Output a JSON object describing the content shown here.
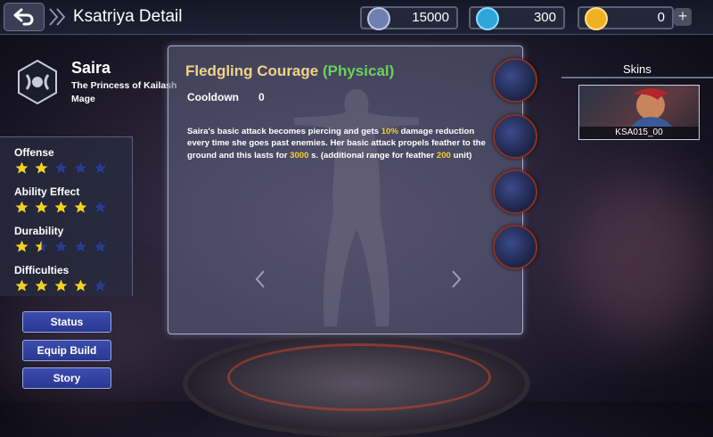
{
  "header": {
    "back_icon": "back-arrow-icon",
    "title": "Ksatriya Detail"
  },
  "resources": [
    {
      "name": "battle-point",
      "icon": "battle-point-icon",
      "value": "15000",
      "color": "#6f7fb0"
    },
    {
      "name": "diamond",
      "icon": "diamond-icon",
      "value": "300",
      "color": "#2fa6d8"
    },
    {
      "name": "ticket",
      "icon": "ticket-icon",
      "value": "0",
      "color": "#f0b020"
    }
  ],
  "hero": {
    "name": "Saira",
    "title": "The Princess of Kailash",
    "role": "Mage"
  },
  "stats": [
    {
      "label": "Offense",
      "rating": 2
    },
    {
      "label": "Ability Effect",
      "rating": 4
    },
    {
      "label": "Durability",
      "rating": 1.5
    },
    {
      "label": "Difficulties",
      "rating": 4
    }
  ],
  "buttons": {
    "status": "Status",
    "equip_build": "Equip Build",
    "story": "Story"
  },
  "ability": {
    "name": "Fledgling Courage",
    "type": "(Physical)",
    "cooldown_label": "Cooldown",
    "cooldown_value": "0",
    "desc": {
      "p1": "Saira's basic attack becomes piercing and gets ",
      "h1": "10%",
      "p2": " damage reduction every time she goes past enemies. Her basic attack propels feather to the ground and this lasts for ",
      "h2": "3000",
      "p3": " s. (additional range for feather ",
      "h3": "200",
      "p4": " unit)"
    }
  },
  "skins": {
    "label": "Skins",
    "items": [
      {
        "label": "KSA015_00"
      }
    ]
  },
  "colors": {
    "star_filled": "#f5d21a",
    "star_empty": "#2b3c86",
    "ability_name": "#f2d28a",
    "physical": "#69d25a",
    "highlight": "#f3d02e"
  }
}
